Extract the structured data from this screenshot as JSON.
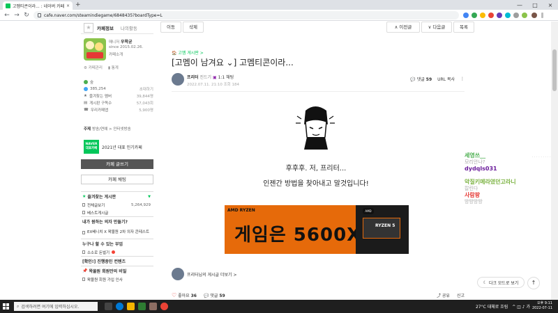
{
  "browser": {
    "tab_title": "고멤티콘이라... : 네이버 카페",
    "tab_close": "×",
    "new_tab": "+",
    "url": "cafe.naver.com/steamindiegame/6848435?boardType=L",
    "back": "←",
    "forward": "→",
    "reload": "↻",
    "win_min": "—",
    "win_max": "□",
    "win_close": "×"
  },
  "sidebar": {
    "tab_info": "카페정보",
    "tab_activity": "나의활동",
    "manager_label": "매니저",
    "manager_name": "우왁굳",
    "since": "since 2015.02.26.",
    "cafe_intro": "카페소개",
    "link_manage": "카페관리",
    "link_stats": "통계",
    "level": "숲",
    "member_count": "385,254",
    "invite": "초대하기",
    "stat_fav_label": "즐겨찾는 멤버",
    "stat_fav_value": "39,844명",
    "stat_sub_label": "게시판 구독수",
    "stat_sub_value": "57,043회",
    "stat_alert_label": "우리카페앱",
    "stat_alert_value": "5,900명",
    "subject_label": "주제",
    "subject_value": "방송/연예 > 인터넷방송",
    "naver_badge": "NAVER 대표카페",
    "naver_badge_text": "2021년 대표 인기카페",
    "write_button": "카페 글쓰기",
    "chat_button": "카페 채팅",
    "sections": [
      {
        "title": "즐겨찾는 게시판",
        "items": [
          {
            "label": "전체글보기",
            "count": "5,264,929"
          },
          {
            "label": "베스트게시글",
            "count": ""
          }
        ]
      },
      {
        "title": "내가 원하는 의자 만들기?",
        "items": [
          {
            "label": "EX베니치 X 왁물원 2차 의자 콘테스트",
            "count": ""
          }
        ]
      },
      {
        "title": "누구나 할 수 있는 부업",
        "items": [
          {
            "label": "소소로 돈벌기",
            "count": ""
          }
        ]
      },
      {
        "title": "[확인!] 진행중인 컨텐츠",
        "items": []
      },
      {
        "title": "왁물원 회원만의 비밀",
        "items": [
          {
            "label": "왁물원 회원 가입 인사",
            "count": ""
          }
        ]
      }
    ]
  },
  "article": {
    "btn_move": "이동",
    "btn_delete": "삭제",
    "btn_prev": "∧ 이전글",
    "btn_next": "∨ 다음글",
    "btn_list": "목록",
    "category": "고멤 게시판 >",
    "title": "[고멤이 남겨요 ⌄] 고멤티콘이라...",
    "author_name": "프리터",
    "author_grade": "진드기",
    "author_chat": "1:1 채팅",
    "date": "2022.07.11. 21:10",
    "views": "조회 184",
    "comment_label": "댓글",
    "comment_count": "59",
    "url_copy": "URL 복사",
    "more_menu": "⋮",
    "line1": "후후후. 저, 프리터...",
    "line2": "인젠간 방법을 찾아내고 말것입니다!",
    "ad_brand": "AMD RYZEN",
    "ad_text": "게임은 5600X",
    "ad_chip": "RYZEN 5",
    "ad_pill": "AMD",
    "more_posts": "프리터님의 게시글 더보기 >",
    "like_label": "좋아요",
    "like_count": "36",
    "reply_label": "댓글",
    "reply_count": "59",
    "share": "공유",
    "report": "신고"
  },
  "chat": [
    {
      "name": "세영쓰__",
      "text": "모리안나?",
      "color": "#4caf50"
    },
    {
      "name": "dydqls031",
      "text": "",
      "color": "#6a1b9a"
    },
    {
      "name": "악질키메라였던고라니",
      "text": "칼린다",
      "color": "#7cb342"
    },
    {
      "name": "사람팡",
      "text": "방방방방",
      "color": "#e53935"
    }
  ],
  "dark_mode_button": "다크 모드로 보기",
  "top_button": "↑",
  "taskbar": {
    "search_placeholder": "검색하려면 여기에 입력하십시오.",
    "weather": "27°C 대체로 흐림",
    "time": "오후 9:11",
    "date": "2022-07-11"
  }
}
